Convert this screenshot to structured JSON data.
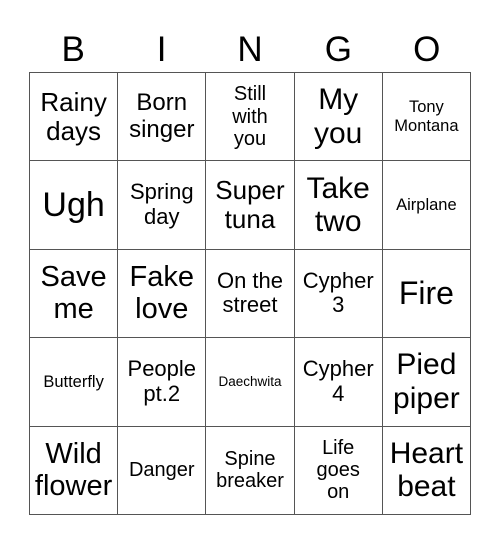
{
  "header": {
    "letters": [
      "B",
      "I",
      "N",
      "G",
      "O"
    ]
  },
  "grid": {
    "rows": [
      [
        "Rainy days",
        "Born singer",
        "Still with you",
        "My you",
        "Tony Montana"
      ],
      [
        "Ugh",
        "Spring day",
        "Super tuna",
        "Take two",
        "Airplane"
      ],
      [
        "Save me",
        "Fake love",
        "On the street",
        "Cypher 3",
        "Fire"
      ],
      [
        "Butterfly",
        "People pt.2",
        "Daechwita",
        "Cypher 4",
        "Pied piper"
      ],
      [
        "Wild flower",
        "Danger",
        "Spine breaker",
        "Life goes on",
        "Heart beat"
      ]
    ]
  }
}
